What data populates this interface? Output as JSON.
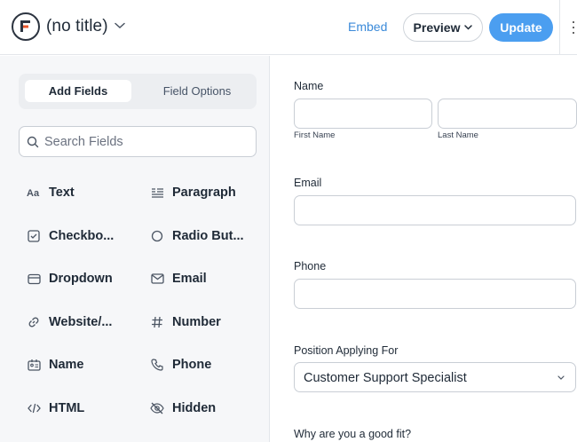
{
  "header": {
    "title": "(no title)",
    "embed_label": "Embed",
    "preview_label": "Preview",
    "update_label": "Update"
  },
  "sidebar": {
    "tabs": [
      {
        "label": "Add Fields",
        "active": true
      },
      {
        "label": "Field Options",
        "active": false
      }
    ],
    "search_placeholder": "Search Fields",
    "fields": [
      {
        "label": "Text",
        "icon": "text-icon"
      },
      {
        "label": "Paragraph",
        "icon": "paragraph-icon"
      },
      {
        "label": "Checkbo...",
        "icon": "checkbox-icon"
      },
      {
        "label": "Radio But...",
        "icon": "radio-icon"
      },
      {
        "label": "Dropdown",
        "icon": "dropdown-icon"
      },
      {
        "label": "Email",
        "icon": "email-icon"
      },
      {
        "label": "Website/...",
        "icon": "link-icon"
      },
      {
        "label": "Number",
        "icon": "hash-icon"
      },
      {
        "label": "Name",
        "icon": "name-card-icon"
      },
      {
        "label": "Phone",
        "icon": "phone-icon"
      },
      {
        "label": "HTML",
        "icon": "code-icon"
      },
      {
        "label": "Hidden",
        "icon": "eye-off-icon"
      }
    ]
  },
  "form": {
    "name_label": "Name",
    "first_name_label": "First Name",
    "last_name_label": "Last Name",
    "email_label": "Email",
    "phone_label": "Phone",
    "position_label": "Position Applying For",
    "position_value": "Customer Support Specialist",
    "fit_label": "Why are you a good fit?"
  },
  "colors": {
    "accent": "#4b9ef0",
    "embed_link": "#3b8ad9",
    "sidebar_bg": "#f6f7f9"
  }
}
